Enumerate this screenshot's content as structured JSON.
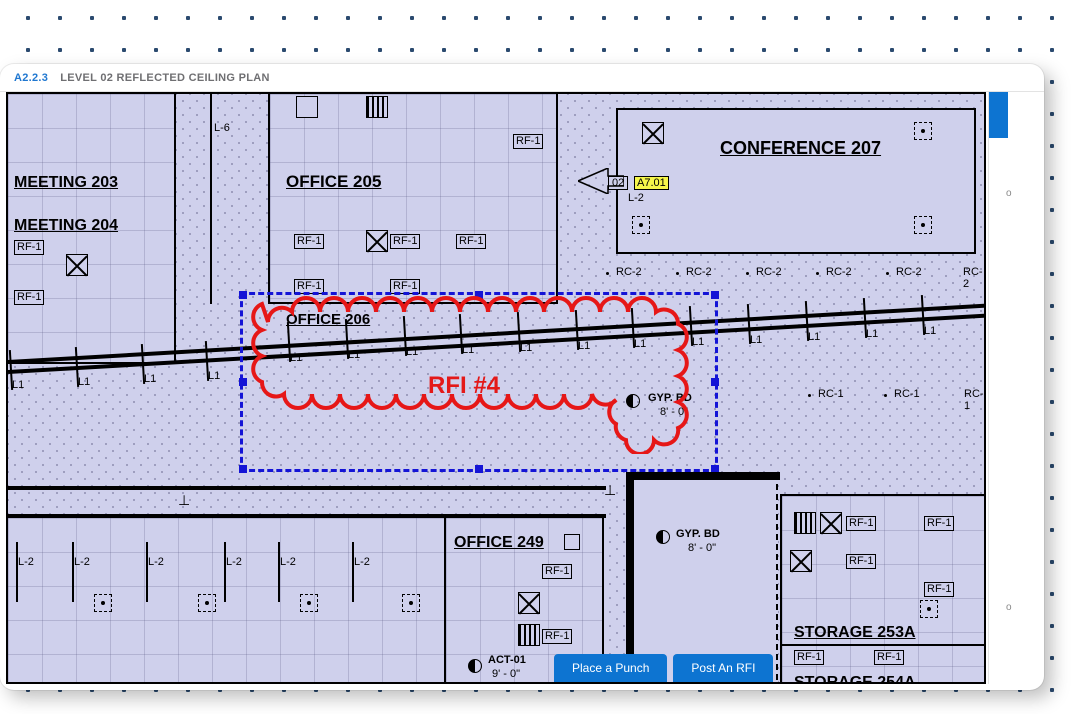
{
  "header": {
    "code": "A2.2.3",
    "title": "LEVEL 02 REFLECTED CEILING PLAN"
  },
  "rooms": {
    "meeting203": "MEETING  203",
    "meeting204": "MEETING  204",
    "office205": "OFFICE  205",
    "office206": "OFFICE  206",
    "office249": "OFFICE  249",
    "conference207": "CONFERENCE  207",
    "storage253a": "STORAGE  253A",
    "storage254a": "STORAGE  254A"
  },
  "tags": {
    "rf1": "RF-1",
    "l1": "L1",
    "l2": "L-2",
    "l6": "L-6",
    "rc1": "RC-1",
    "rc2": "RC-2",
    "act01": "ACT-01",
    "act01_dim": "9' - 0\"",
    "gypbd": "GYP. BD",
    "gypbd_dim": "8' - 0\"",
    "ref02": "02",
    "a701": "A7.01"
  },
  "rfi": {
    "label": "RFI #4"
  },
  "buttons": {
    "punch": "Place a Punch",
    "rfi": "Post An RFI"
  },
  "sidebar_hint": "o"
}
